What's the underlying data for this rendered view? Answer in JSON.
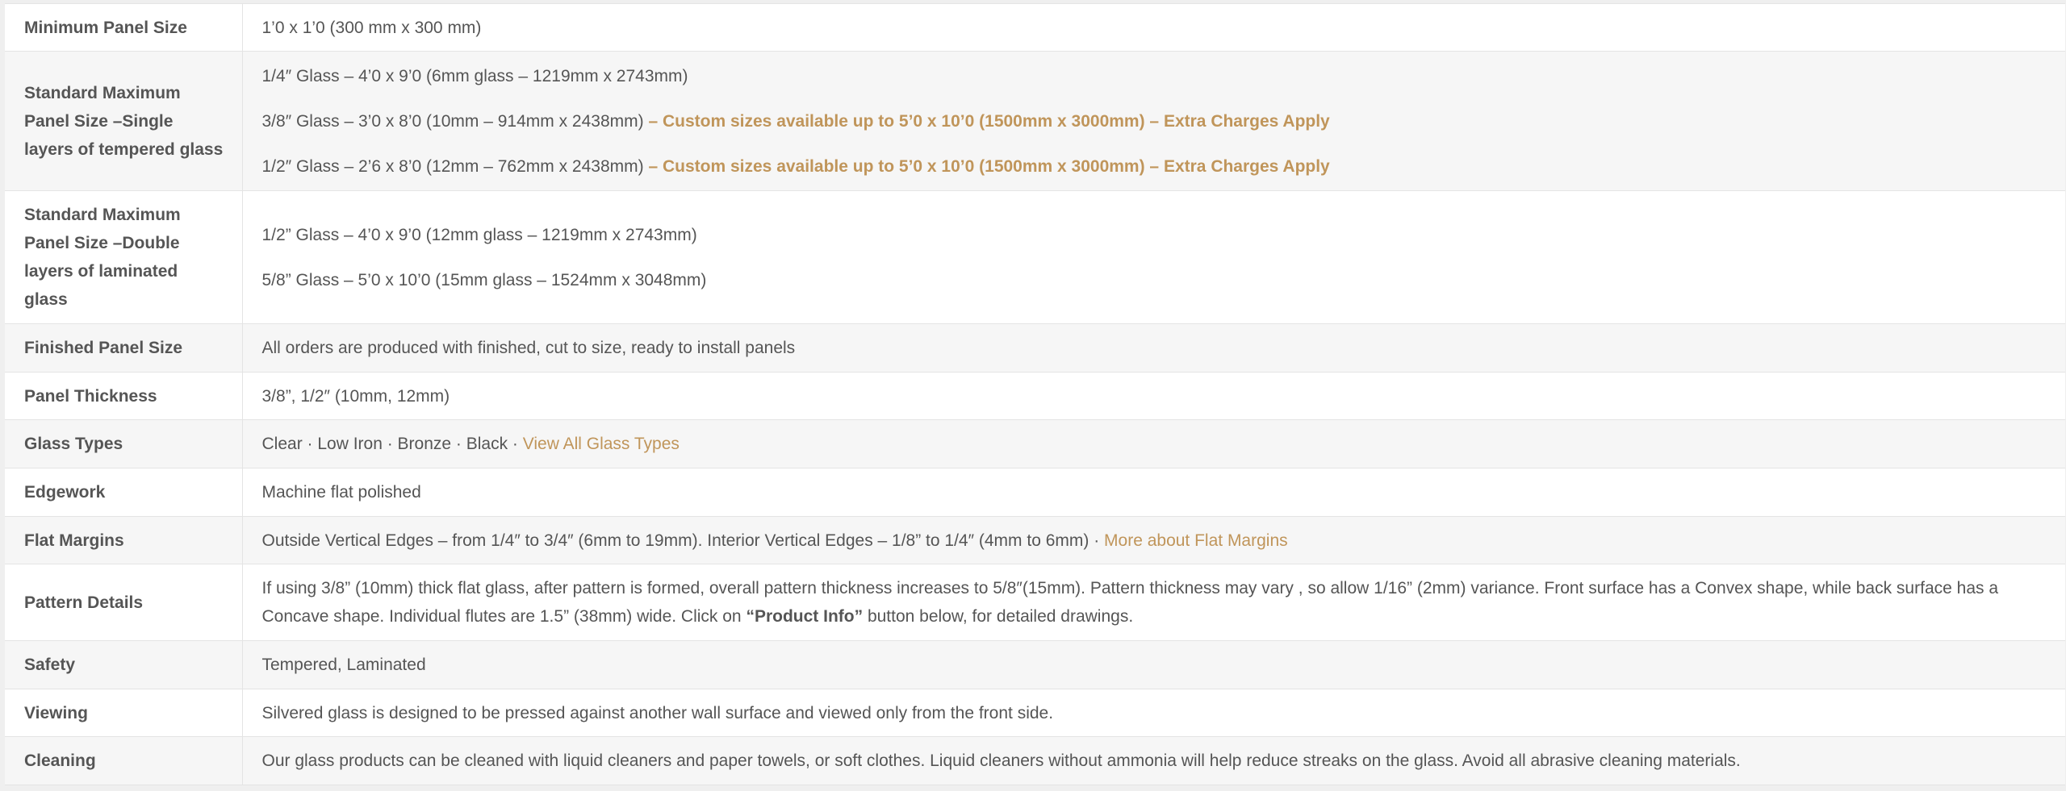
{
  "rows": [
    {
      "label": "Minimum Panel Size",
      "value": "1’0 x 1’0  (300 mm x 300 mm)"
    },
    {
      "label": "Standard Maximum Panel Size –Single layers of tempered glass",
      "lines": [
        {
          "text": "1/4″ Glass – 4’0 x 9’0 (6mm glass – 1219mm x 2743mm)"
        },
        {
          "text": "3/8″ Glass – 3’0 x 8’0 (10mm – 914mm x 2438mm)",
          "note": "– Custom sizes available up to 5’0 x 10’0 (1500mm x 3000mm) – Extra Charges Apply"
        },
        {
          "text": "1/2″ Glass – 2’6 x 8’0 (12mm – 762mm x 2438mm)",
          "note": "– Custom sizes available up to 5’0 x 10’0 (1500mm x 3000mm) – Extra Charges Apply"
        }
      ]
    },
    {
      "label": "Standard Maximum Panel Size –Double layers of laminated glass",
      "lines": [
        {
          "text": "1/2” Glass – 4’0 x 9’0   (12mm glass – 1219mm x 2743mm)"
        },
        {
          "text": "5/8” Glass – 5’0 x 10’0 (15mm glass – 1524mm x 3048mm)"
        }
      ]
    },
    {
      "label": "Finished Panel Size",
      "value": "All orders are produced with finished, cut to size, ready to install panels"
    },
    {
      "label": "Panel Thickness",
      "value": "3/8”, 1/2″ (10mm, 12mm)"
    },
    {
      "label": "Glass Types",
      "value": "Clear · Low Iron · Bronze · Black · ",
      "link": "View All Glass Types"
    },
    {
      "label": "Edgework",
      "value": "Machine flat polished"
    },
    {
      "label": "Flat Margins",
      "value": "Outside Vertical Edges – from 1/4″ to 3/4″ (6mm to 19mm). Interior Vertical Edges – 1/8” to 1/4″ (4mm to 6mm) · ",
      "link": "More about Flat Margins"
    },
    {
      "label": "Pattern Details",
      "value_before": "If using 3/8” (10mm) thick flat glass, after pattern is formed, overall pattern thickness increases to 5/8″(15mm). Pattern thickness may vary , so allow 1/16” (2mm) variance. Front surface has a Convex shape, while back surface has a Concave shape. Individual flutes are 1.5” (38mm) wide. Click on ",
      "value_strong": "“Product Info”",
      "value_after": " button below, for detailed drawings."
    },
    {
      "label": "Safety",
      "value": "Tempered, Laminated"
    },
    {
      "label": "Viewing",
      "value": "Silvered glass is designed to be pressed against another wall surface and viewed only from the front side."
    },
    {
      "label": "Cleaning",
      "value": "Our glass products can be cleaned with liquid cleaners and paper towels, or soft clothes. Liquid cleaners without ammonia will help reduce streaks on the glass. Avoid all abrasive cleaning materials."
    }
  ]
}
